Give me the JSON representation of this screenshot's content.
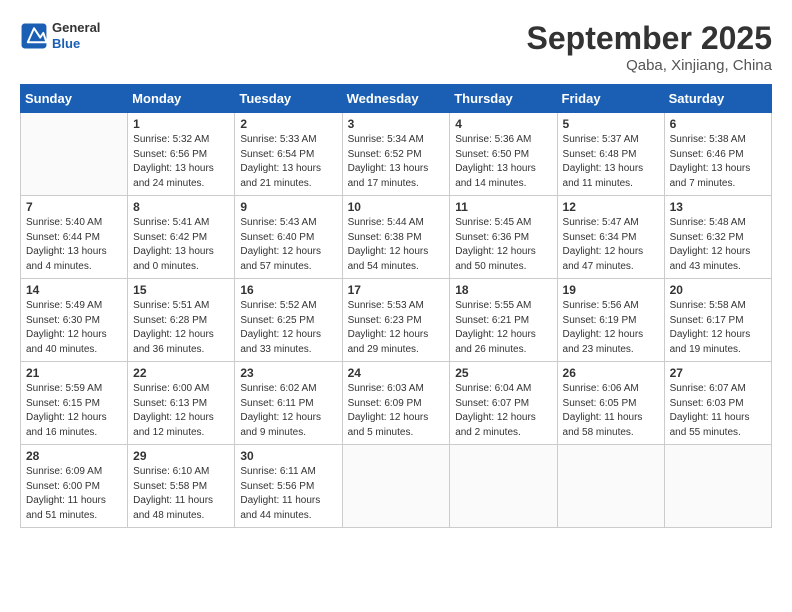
{
  "header": {
    "logo": {
      "general": "General",
      "blue": "Blue"
    },
    "title": "September 2025",
    "location": "Qaba, Xinjiang, China"
  },
  "weekdays": [
    "Sunday",
    "Monday",
    "Tuesday",
    "Wednesday",
    "Thursday",
    "Friday",
    "Saturday"
  ],
  "weeks": [
    [
      {
        "day": "",
        "info": ""
      },
      {
        "day": "1",
        "info": "Sunrise: 5:32 AM\nSunset: 6:56 PM\nDaylight: 13 hours\nand 24 minutes."
      },
      {
        "day": "2",
        "info": "Sunrise: 5:33 AM\nSunset: 6:54 PM\nDaylight: 13 hours\nand 21 minutes."
      },
      {
        "day": "3",
        "info": "Sunrise: 5:34 AM\nSunset: 6:52 PM\nDaylight: 13 hours\nand 17 minutes."
      },
      {
        "day": "4",
        "info": "Sunrise: 5:36 AM\nSunset: 6:50 PM\nDaylight: 13 hours\nand 14 minutes."
      },
      {
        "day": "5",
        "info": "Sunrise: 5:37 AM\nSunset: 6:48 PM\nDaylight: 13 hours\nand 11 minutes."
      },
      {
        "day": "6",
        "info": "Sunrise: 5:38 AM\nSunset: 6:46 PM\nDaylight: 13 hours\nand 7 minutes."
      }
    ],
    [
      {
        "day": "7",
        "info": "Sunrise: 5:40 AM\nSunset: 6:44 PM\nDaylight: 13 hours\nand 4 minutes."
      },
      {
        "day": "8",
        "info": "Sunrise: 5:41 AM\nSunset: 6:42 PM\nDaylight: 13 hours\nand 0 minutes."
      },
      {
        "day": "9",
        "info": "Sunrise: 5:43 AM\nSunset: 6:40 PM\nDaylight: 12 hours\nand 57 minutes."
      },
      {
        "day": "10",
        "info": "Sunrise: 5:44 AM\nSunset: 6:38 PM\nDaylight: 12 hours\nand 54 minutes."
      },
      {
        "day": "11",
        "info": "Sunrise: 5:45 AM\nSunset: 6:36 PM\nDaylight: 12 hours\nand 50 minutes."
      },
      {
        "day": "12",
        "info": "Sunrise: 5:47 AM\nSunset: 6:34 PM\nDaylight: 12 hours\nand 47 minutes."
      },
      {
        "day": "13",
        "info": "Sunrise: 5:48 AM\nSunset: 6:32 PM\nDaylight: 12 hours\nand 43 minutes."
      }
    ],
    [
      {
        "day": "14",
        "info": "Sunrise: 5:49 AM\nSunset: 6:30 PM\nDaylight: 12 hours\nand 40 minutes."
      },
      {
        "day": "15",
        "info": "Sunrise: 5:51 AM\nSunset: 6:28 PM\nDaylight: 12 hours\nand 36 minutes."
      },
      {
        "day": "16",
        "info": "Sunrise: 5:52 AM\nSunset: 6:25 PM\nDaylight: 12 hours\nand 33 minutes."
      },
      {
        "day": "17",
        "info": "Sunrise: 5:53 AM\nSunset: 6:23 PM\nDaylight: 12 hours\nand 29 minutes."
      },
      {
        "day": "18",
        "info": "Sunrise: 5:55 AM\nSunset: 6:21 PM\nDaylight: 12 hours\nand 26 minutes."
      },
      {
        "day": "19",
        "info": "Sunrise: 5:56 AM\nSunset: 6:19 PM\nDaylight: 12 hours\nand 23 minutes."
      },
      {
        "day": "20",
        "info": "Sunrise: 5:58 AM\nSunset: 6:17 PM\nDaylight: 12 hours\nand 19 minutes."
      }
    ],
    [
      {
        "day": "21",
        "info": "Sunrise: 5:59 AM\nSunset: 6:15 PM\nDaylight: 12 hours\nand 16 minutes."
      },
      {
        "day": "22",
        "info": "Sunrise: 6:00 AM\nSunset: 6:13 PM\nDaylight: 12 hours\nand 12 minutes."
      },
      {
        "day": "23",
        "info": "Sunrise: 6:02 AM\nSunset: 6:11 PM\nDaylight: 12 hours\nand 9 minutes."
      },
      {
        "day": "24",
        "info": "Sunrise: 6:03 AM\nSunset: 6:09 PM\nDaylight: 12 hours\nand 5 minutes."
      },
      {
        "day": "25",
        "info": "Sunrise: 6:04 AM\nSunset: 6:07 PM\nDaylight: 12 hours\nand 2 minutes."
      },
      {
        "day": "26",
        "info": "Sunrise: 6:06 AM\nSunset: 6:05 PM\nDaylight: 11 hours\nand 58 minutes."
      },
      {
        "day": "27",
        "info": "Sunrise: 6:07 AM\nSunset: 6:03 PM\nDaylight: 11 hours\nand 55 minutes."
      }
    ],
    [
      {
        "day": "28",
        "info": "Sunrise: 6:09 AM\nSunset: 6:00 PM\nDaylight: 11 hours\nand 51 minutes."
      },
      {
        "day": "29",
        "info": "Sunrise: 6:10 AM\nSunset: 5:58 PM\nDaylight: 11 hours\nand 48 minutes."
      },
      {
        "day": "30",
        "info": "Sunrise: 6:11 AM\nSunset: 5:56 PM\nDaylight: 11 hours\nand 44 minutes."
      },
      {
        "day": "",
        "info": ""
      },
      {
        "day": "",
        "info": ""
      },
      {
        "day": "",
        "info": ""
      },
      {
        "day": "",
        "info": ""
      }
    ]
  ]
}
